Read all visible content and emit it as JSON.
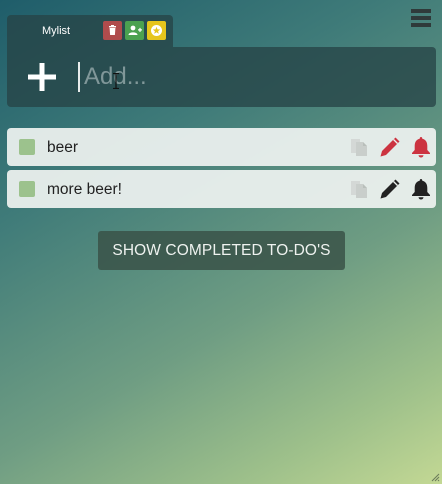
{
  "header": {
    "menu_icon": "hamburger-menu-icon"
  },
  "list_tab": {
    "name": "Mylist",
    "buttons": [
      {
        "icon": "trash-icon",
        "color": "#b04c4d"
      },
      {
        "icon": "add-user-icon",
        "color": "#4ba150"
      },
      {
        "icon": "star-icon",
        "color": "#e6c51c"
      }
    ]
  },
  "add_bar": {
    "plus_icon": "plus-icon",
    "placeholder": "Add...",
    "value": ""
  },
  "todos": [
    {
      "text": "beer",
      "edit_color": "#cc3340",
      "bell_color": "#cc3340"
    },
    {
      "text": "more beer!",
      "edit_color": "#222222",
      "bell_color": "#222222"
    }
  ],
  "show_completed_label": "SHOW COMPLETED TO-DO'S",
  "colors": {
    "checkbox": "#9cc28d",
    "panel": "#26444a"
  }
}
